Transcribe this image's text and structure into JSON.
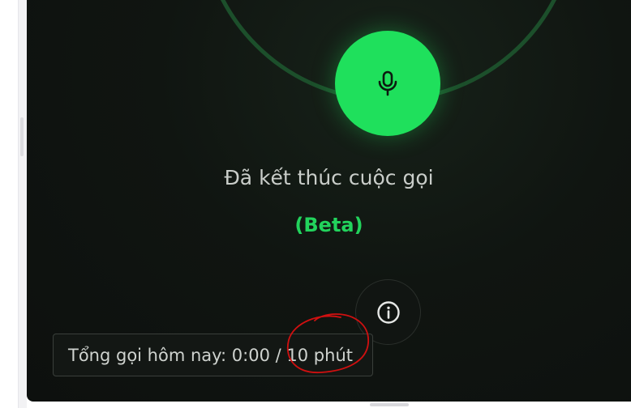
{
  "call": {
    "status": "Đã kết thúc cuộc gọi",
    "badge": "(Beta)"
  },
  "usage": {
    "prefix": "Tổng gọi hôm nay: ",
    "used": "0:00",
    "separator": " / ",
    "limit": "10 phút"
  },
  "icons": {
    "mic": "microphone-icon",
    "info": "info-icon"
  },
  "colors": {
    "accent": "#1fe05c",
    "panel_bg": "#0d100e",
    "ring": "#1c4f2b",
    "annotation": "#d01010"
  }
}
